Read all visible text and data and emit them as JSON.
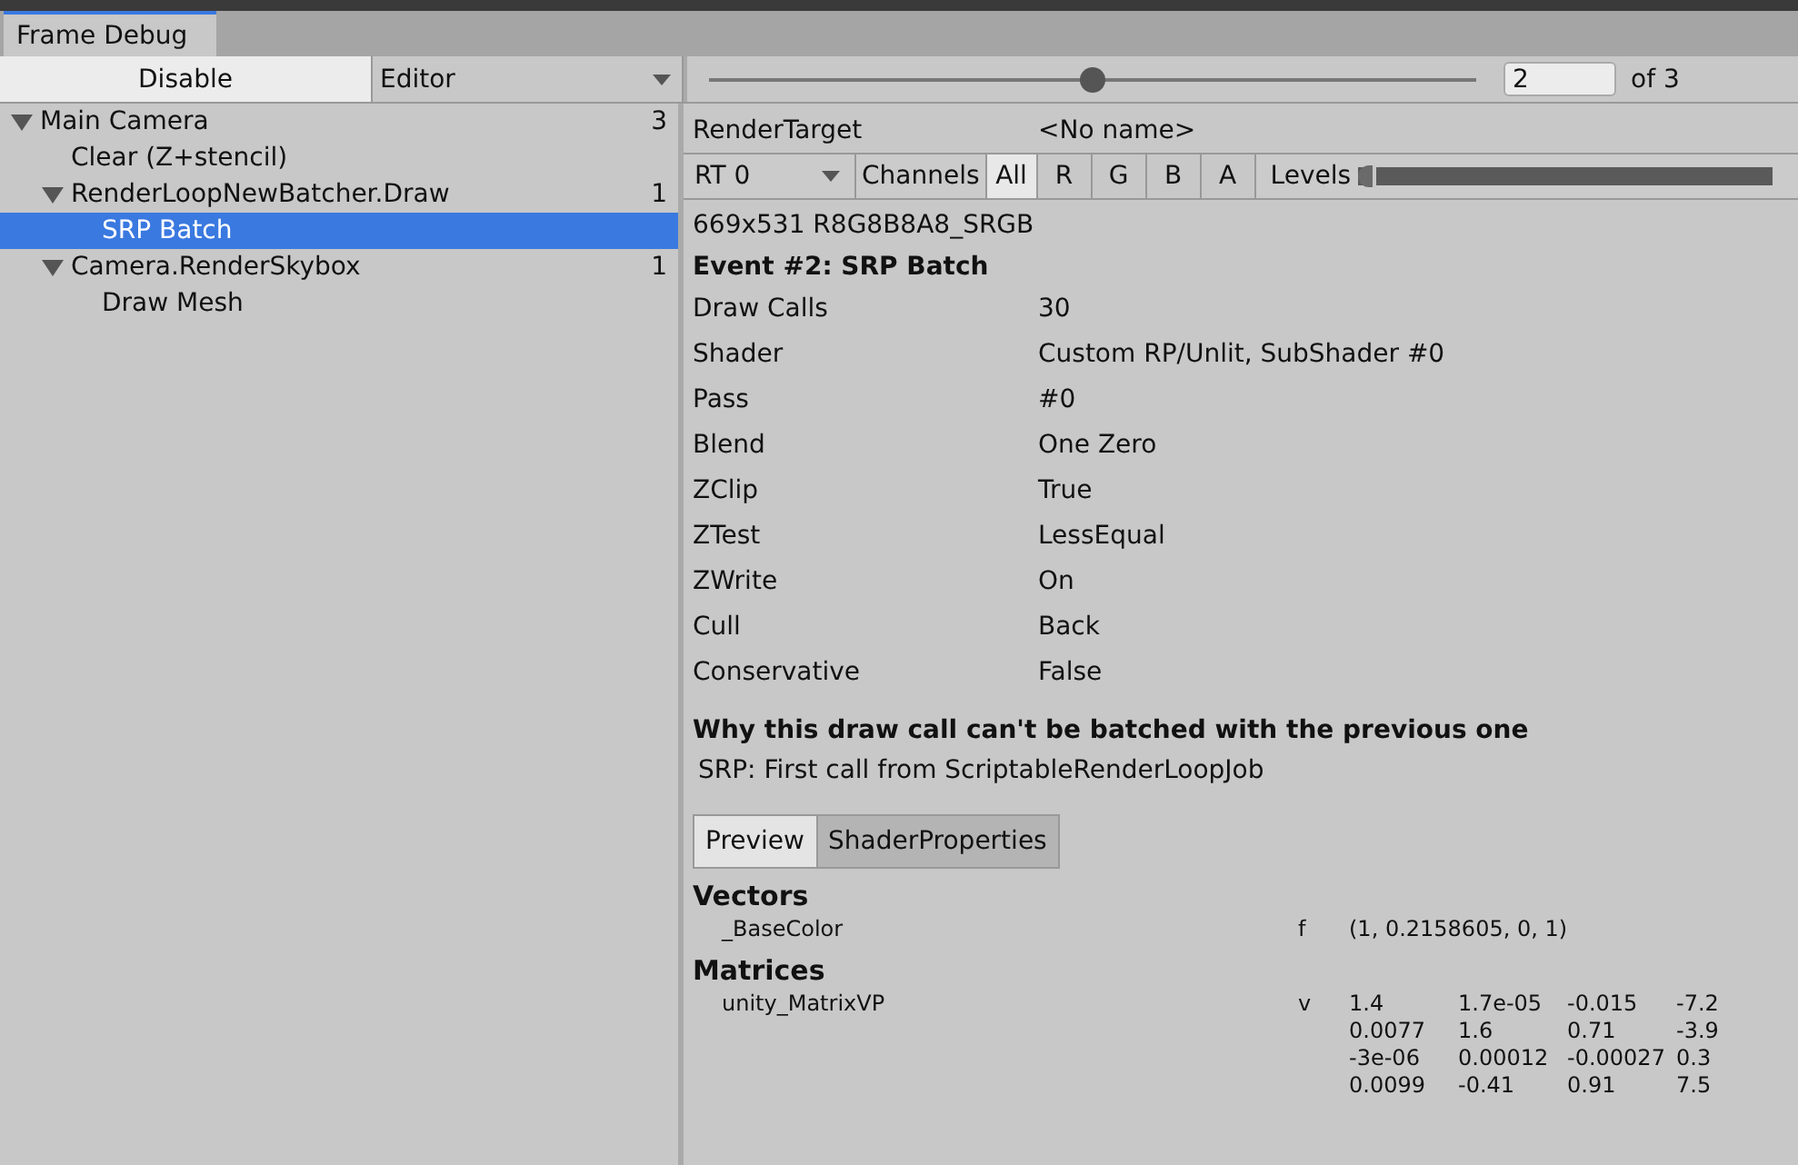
{
  "window": {
    "tab": "Frame Debug"
  },
  "toolbar": {
    "disable_button": "Disable",
    "target_dropdown": "Editor",
    "event_slider": {
      "level": 0.5
    },
    "event_field": "2",
    "event_total": "of 3"
  },
  "tree": [
    {
      "label": "Main Camera",
      "count": "3",
      "expanded": true,
      "selected": false,
      "children": [
        {
          "label": "Clear (Z+stencil)",
          "selected": false
        },
        {
          "label": "RenderLoopNewBatcher.Draw",
          "count": "1",
          "expanded": true,
          "selected": false,
          "children": [
            {
              "label": "SRP Batch",
              "selected": true
            }
          ]
        },
        {
          "label": "Camera.RenderSkybox",
          "count": "1",
          "expanded": true,
          "selected": false,
          "children": [
            {
              "label": "Draw Mesh",
              "selected": false
            }
          ]
        }
      ]
    }
  ],
  "details": {
    "render_target": {
      "label": "RenderTarget",
      "value": "<No name>"
    },
    "rt_dropdown": "RT 0",
    "channels_label": "Channels",
    "channels": [
      {
        "label": "All",
        "selected": true
      },
      {
        "label": "R",
        "selected": false
      },
      {
        "label": "G",
        "selected": false
      },
      {
        "label": "B",
        "selected": false
      },
      {
        "label": "A",
        "selected": false
      }
    ],
    "levels_label": "Levels",
    "levels_slider": {
      "level": 0
    },
    "format": "669x531 R8G8B8A8_SRGB",
    "event_title": "Event #2: SRP Batch",
    "properties": [
      {
        "label": "Draw Calls",
        "value": "30"
      },
      {
        "label": "Shader",
        "value": "Custom RP/Unlit, SubShader #0"
      },
      {
        "label": "Pass",
        "value": "#0"
      },
      {
        "label": "Blend",
        "value": "One Zero"
      },
      {
        "label": "ZClip",
        "value": "True"
      },
      {
        "label": "ZTest",
        "value": "LessEqual"
      },
      {
        "label": "ZWrite",
        "value": "On"
      },
      {
        "label": "Cull",
        "value": "Back"
      },
      {
        "label": "Conservative",
        "value": "False"
      }
    ],
    "batch_heading": "Why this draw call can't be batched with the previous one",
    "batch_reason": "SRP: First call from ScriptableRenderLoopJob",
    "tabs": [
      {
        "label": "Preview",
        "selected": true
      },
      {
        "label": "ShaderProperties",
        "selected": false
      }
    ],
    "shader_properties": [
      {
        "heading": "Vectors",
        "rows": [
          {
            "name": "_BaseColor",
            "type": "f",
            "values": [
              [
                "(1, 0.2158605, 0, 1)"
              ]
            ]
          }
        ]
      },
      {
        "heading": "Matrices",
        "rows": [
          {
            "name": "unity_MatrixVP",
            "type": "v",
            "values": [
              [
                "1.4",
                "1.7e-05",
                "-0.015",
                "-7.2"
              ],
              [
                "0.0077",
                "1.6",
                "0.71",
                "-3.9"
              ],
              [
                "-3e-06",
                "0.00012",
                "-0.00027",
                "0.3"
              ],
              [
                "0.0099",
                "-0.41",
                "0.91",
                "7.5"
              ]
            ]
          }
        ]
      }
    ]
  }
}
